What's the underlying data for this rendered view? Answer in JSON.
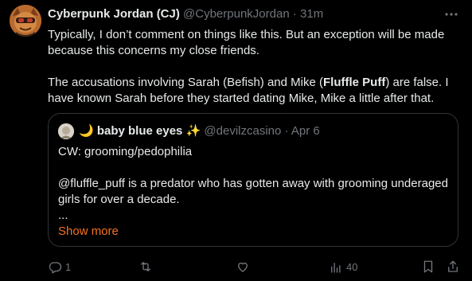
{
  "tweet": {
    "display_name": "Cyberpunk Jordan (CJ)",
    "handle": "@CyberpunkJordan",
    "separator": "·",
    "time": "31m",
    "paragraphs": [
      "Typically, I don’t comment on things like this. But an exception will be made because this concerns my close friends."
    ],
    "p2_part1": "The accusations involving Sarah (Befish) and Mike (",
    "p2_bold": "Fluffle Puff",
    "p2_part2": ") are false. I have known Sarah before they started dating Mike, Mike a little after that."
  },
  "quote": {
    "display_name": "🌙 baby blue eyes ✨",
    "handle": "@devilzcasino",
    "separator": "·",
    "time": "Apr 6",
    "line1": "CW: grooming/pedophilia",
    "line2": "@fluffle_puff is a predator who has gotten away with grooming underaged girls for over a decade.",
    "ellipsis": "...",
    "show_more": "Show more"
  },
  "actions": {
    "reply_count": "1",
    "retweet_count": "",
    "like_count": "",
    "views_count": "40"
  },
  "colors": {
    "background": "#000000",
    "text": "#e7e9ea",
    "muted": "#71767b",
    "border": "#2f3336",
    "show_more": "#f4711f"
  }
}
